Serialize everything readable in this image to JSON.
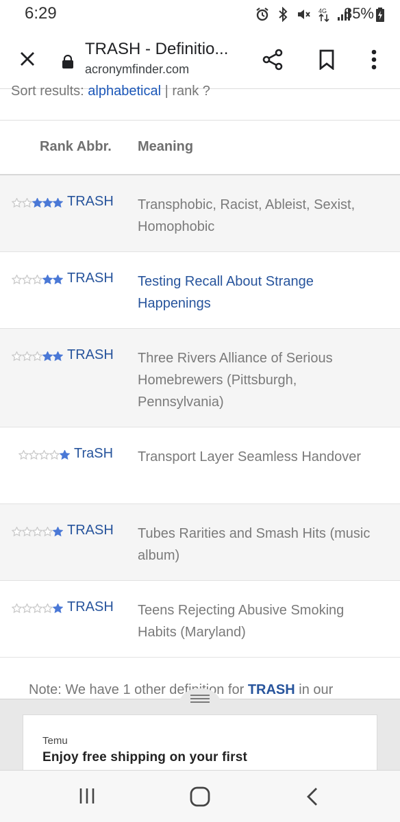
{
  "status_bar": {
    "time": "6:29",
    "battery": "85%",
    "icons": [
      "alarm-icon",
      "bluetooth-icon",
      "mute-icon",
      "data-arrows-icon",
      "signal-icon",
      "battery-charging-icon"
    ]
  },
  "toolbar": {
    "title": "TRASH - Definitio...",
    "url": "acronymfinder.com",
    "icons": [
      "close-icon",
      "lock-icon",
      "share-icon",
      "bookmark-icon",
      "more-vert-icon"
    ]
  },
  "sort": {
    "prefix": "Sort results: ",
    "option_alpha": "alphabetical",
    "separator": " | ",
    "option_rank": "rank ?"
  },
  "table": {
    "header_rank_abbr": "Rank Abbr.",
    "header_meaning": "Meaning",
    "rows": [
      {
        "stars_filled": 3,
        "abbr": "TRASH",
        "meaning": "Transphobic, Racist, Ableist, Sexist, Homophobic",
        "meaning_is_link": false
      },
      {
        "stars_filled": 2,
        "abbr": "TRASH",
        "meaning": "Testing Recall About Strange Happenings",
        "meaning_is_link": true
      },
      {
        "stars_filled": 2,
        "abbr": "TRASH",
        "meaning": "Three Rivers Alliance of Serious Homebrewers (Pittsburgh, Pennsylvania)",
        "meaning_is_link": false
      },
      {
        "stars_filled": 1,
        "abbr": "TraSH",
        "meaning": "Transport Layer Seamless Handover",
        "meaning_is_link": false
      },
      {
        "stars_filled": 1,
        "abbr": "TRASH",
        "meaning": "Tubes Rarities and Smash Hits (music album)",
        "meaning_is_link": false
      },
      {
        "stars_filled": 1,
        "abbr": "TRASH",
        "meaning": "Teens Rejecting Abusive Smoking Habits (Maryland)",
        "meaning_is_link": false
      }
    ]
  },
  "note": {
    "prefix": "Note: We have 1 other definition for ",
    "term": "TRASH",
    "suffix": " in our"
  },
  "ad": {
    "brand": "Temu",
    "text": "Enjoy free shipping on your first"
  },
  "nav_bar": {
    "icons": [
      "recents-icon",
      "home-icon",
      "back-icon"
    ]
  },
  "colors": {
    "link_blue": "#27549c",
    "star_blue": "#4a78d6",
    "star_empty": "#c8c8c8",
    "row_alt": "#f5f5f5"
  }
}
